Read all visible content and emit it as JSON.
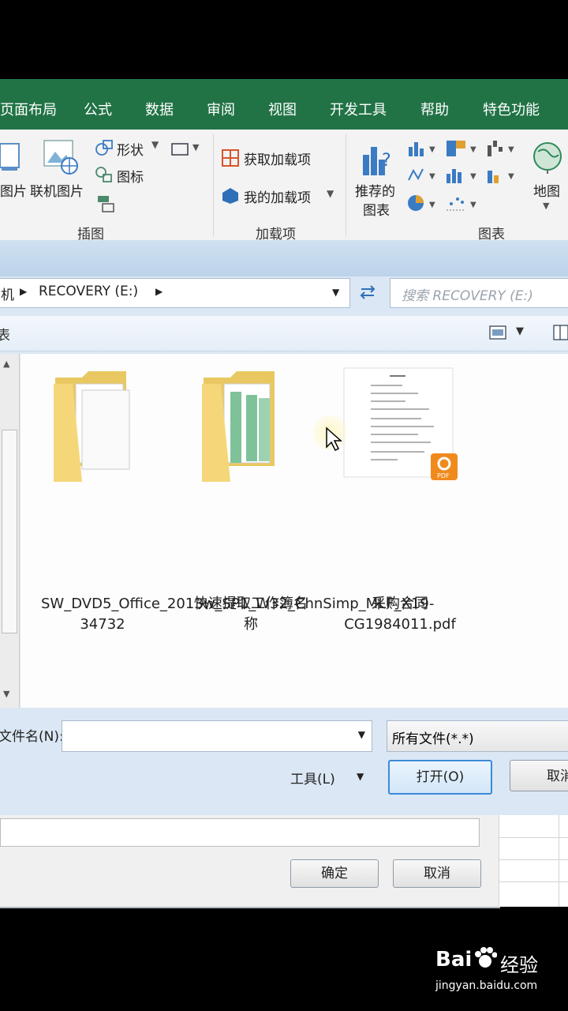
{
  "ribbon": {
    "tabs": [
      "页面布局",
      "公式",
      "数据",
      "审阅",
      "视图",
      "开发工具",
      "帮助",
      "特色功能"
    ],
    "illustrations": {
      "picture_label": "图片",
      "online_picture_label": "联机图片",
      "shapes_label": "形状",
      "icons_label": "图标",
      "group_label": "插图"
    },
    "addins": {
      "get_addins_label": "获取加载项",
      "my_addins_label": "我的加载项",
      "group_label": "加载项"
    },
    "charts": {
      "recommended_line1": "推荐的",
      "recommended_line2": "图表",
      "map_label": "地图",
      "group_label": "图表"
    }
  },
  "dialog": {
    "address": {
      "prefix": "机",
      "location": "RECOVERY (E:)"
    },
    "search": {
      "placeholder": "搜索 RECOVERY (E:)"
    },
    "toolbar": {
      "left_fragment": "表"
    },
    "files": [
      {
        "name": "SW_DVD5_Office_2013w_SP1_W32_ChnSimp_MLF_X19-34732",
        "type": "folder"
      },
      {
        "name": "快速提取工作簿名称",
        "type": "folder"
      },
      {
        "name": "采购合同CG1984011.pdf",
        "type": "pdf"
      }
    ],
    "filename_label": "文件名(N):",
    "filename_value": "",
    "filetype_value": "所有文件(*.*)",
    "tools_label": "工具(L)",
    "open_label": "打开(O)",
    "cancel_label": "取消"
  },
  "back_dialog": {
    "ok_label": "确定",
    "cancel_label": "取消"
  },
  "watermark": {
    "brand": "Bai",
    "brand2": "经验",
    "url": "jingyan.baidu.com"
  },
  "colors": {
    "ribbon_green": "#217346",
    "dialog_blue": "#dbe7f4",
    "pdf_badge": "#f08a1d"
  }
}
